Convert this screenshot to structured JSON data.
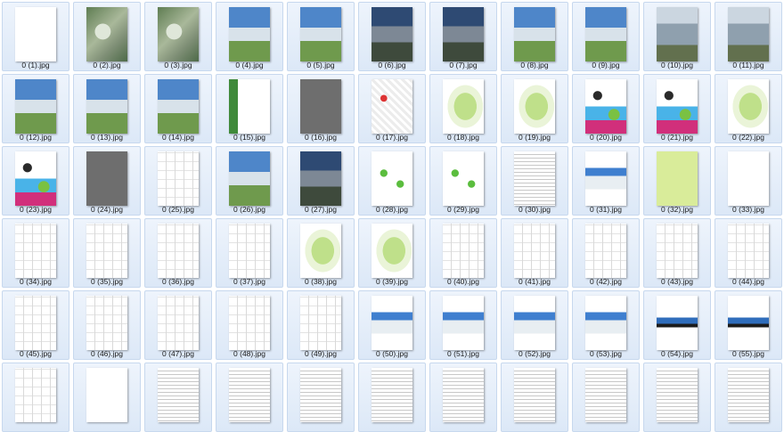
{
  "files": [
    {
      "name": "0 (1).jpg",
      "kind": "cover"
    },
    {
      "name": "0 (2).jpg",
      "kind": "aerial"
    },
    {
      "name": "0 (3).jpg",
      "kind": "aerial"
    },
    {
      "name": "0 (4).jpg",
      "kind": "render_sky"
    },
    {
      "name": "0 (5).jpg",
      "kind": "render_sky"
    },
    {
      "name": "0 (6).jpg",
      "kind": "render_dusk"
    },
    {
      "name": "0 (7).jpg",
      "kind": "render_dusk"
    },
    {
      "name": "0 (8).jpg",
      "kind": "render_sky"
    },
    {
      "name": "0 (9).jpg",
      "kind": "render_sky"
    },
    {
      "name": "0 (10).jpg",
      "kind": "render_grey"
    },
    {
      "name": "0 (11).jpg",
      "kind": "render_grey"
    },
    {
      "name": "0 (12).jpg",
      "kind": "render_sky"
    },
    {
      "name": "0 (13).jpg",
      "kind": "render_sky"
    },
    {
      "name": "0 (14).jpg",
      "kind": "render_sky"
    },
    {
      "name": "0 (15).jpg",
      "kind": "title_green"
    },
    {
      "name": "0 (16).jpg",
      "kind": "grey_page"
    },
    {
      "name": "0 (17).jpg",
      "kind": "site_map"
    },
    {
      "name": "0 (18).jpg",
      "kind": "plan_green"
    },
    {
      "name": "0 (19).jpg",
      "kind": "plan_green"
    },
    {
      "name": "0 (20).jpg",
      "kind": "diagram_color"
    },
    {
      "name": "0 (21).jpg",
      "kind": "diagram_color"
    },
    {
      "name": "0 (22).jpg",
      "kind": "plan_green"
    },
    {
      "name": "0 (23).jpg",
      "kind": "diagram_color"
    },
    {
      "name": "0 (24).jpg",
      "kind": "grey_page"
    },
    {
      "name": "0 (25).jpg",
      "kind": "plan_line"
    },
    {
      "name": "0 (26).jpg",
      "kind": "render_sky"
    },
    {
      "name": "0 (27).jpg",
      "kind": "render_dusk"
    },
    {
      "name": "0 (28).jpg",
      "kind": "diagram_dots"
    },
    {
      "name": "0 (29).jpg",
      "kind": "diagram_dots"
    },
    {
      "name": "0 (30).jpg",
      "kind": "text"
    },
    {
      "name": "0 (31).jpg",
      "kind": "elevation"
    },
    {
      "name": "0 (32).jpg",
      "kind": "yellow_page"
    },
    {
      "name": "0 (33).jpg",
      "kind": "cover"
    },
    {
      "name": "0 (34).jpg",
      "kind": "plan_line"
    },
    {
      "name": "0 (35).jpg",
      "kind": "plan_line"
    },
    {
      "name": "0 (36).jpg",
      "kind": "plan_line"
    },
    {
      "name": "0 (37).jpg",
      "kind": "plan_line"
    },
    {
      "name": "0 (38).jpg",
      "kind": "plan_green"
    },
    {
      "name": "0 (39).jpg",
      "kind": "plan_green"
    },
    {
      "name": "0 (40).jpg",
      "kind": "plan_line"
    },
    {
      "name": "0 (41).jpg",
      "kind": "plan_line"
    },
    {
      "name": "0 (42).jpg",
      "kind": "plan_line"
    },
    {
      "name": "0 (43).jpg",
      "kind": "plan_line"
    },
    {
      "name": "0 (44).jpg",
      "kind": "plan_line"
    },
    {
      "name": "0 (45).jpg",
      "kind": "plan_line"
    },
    {
      "name": "0 (46).jpg",
      "kind": "plan_line"
    },
    {
      "name": "0 (47).jpg",
      "kind": "plan_line"
    },
    {
      "name": "0 (48).jpg",
      "kind": "plan_line"
    },
    {
      "name": "0 (49).jpg",
      "kind": "plan_line"
    },
    {
      "name": "0 (50).jpg",
      "kind": "elevation"
    },
    {
      "name": "0 (51).jpg",
      "kind": "elevation"
    },
    {
      "name": "0 (52).jpg",
      "kind": "elevation"
    },
    {
      "name": "0 (53).jpg",
      "kind": "elevation"
    },
    {
      "name": "0 (54).jpg",
      "kind": "elevation_dark"
    },
    {
      "name": "0 (55).jpg",
      "kind": "elevation_dark"
    },
    {
      "name": "",
      "kind": "plan_line"
    },
    {
      "name": "",
      "kind": "cover"
    },
    {
      "name": "",
      "kind": "text"
    },
    {
      "name": "",
      "kind": "text"
    },
    {
      "name": "",
      "kind": "text"
    },
    {
      "name": "",
      "kind": "text"
    },
    {
      "name": "",
      "kind": "text"
    },
    {
      "name": "",
      "kind": "text"
    },
    {
      "name": "",
      "kind": "text"
    },
    {
      "name": "",
      "kind": "text"
    },
    {
      "name": "",
      "kind": "text"
    }
  ]
}
